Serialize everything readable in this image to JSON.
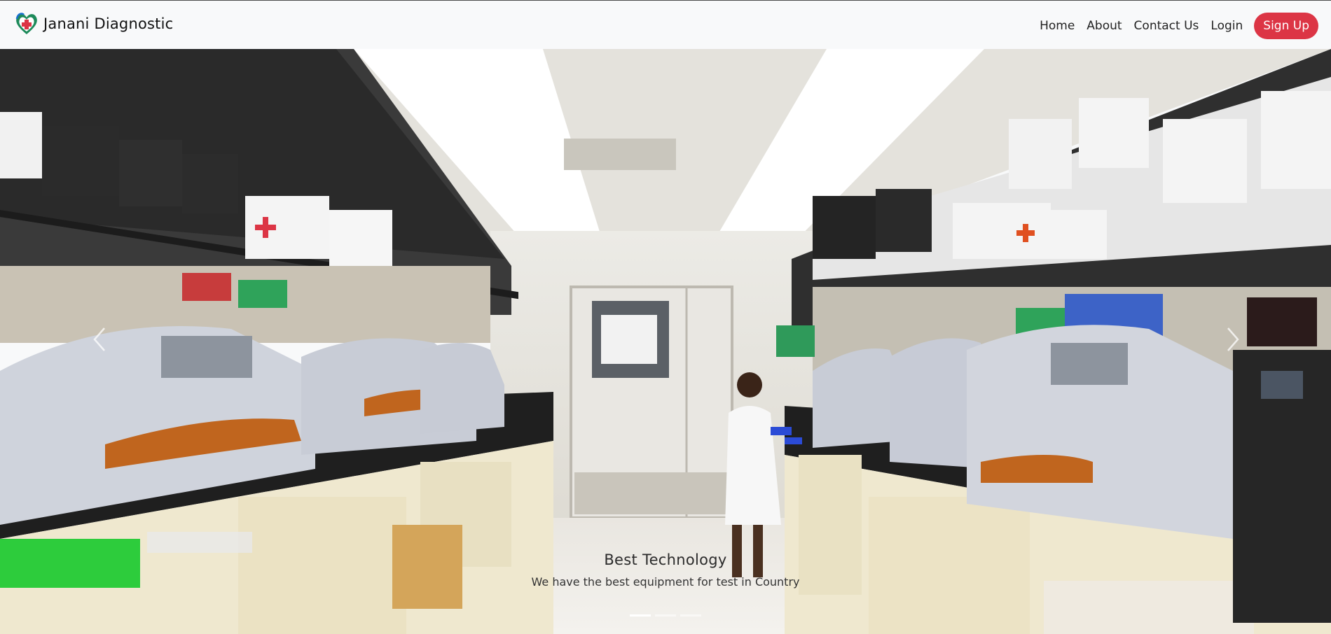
{
  "brand": {
    "name": "Janani Diagnostic",
    "logo_icon": "heart-cross-logo-icon"
  },
  "nav": {
    "items": [
      {
        "label": "Home"
      },
      {
        "label": "About"
      },
      {
        "label": "Contact Us"
      },
      {
        "label": "Login"
      }
    ],
    "signup_label": "Sign Up"
  },
  "colors": {
    "accent": "#dc3545",
    "navbar_bg": "#f8f9fa"
  },
  "carousel": {
    "slide_image": "laboratory-photo",
    "caption_title": "Best Technology",
    "caption_text": "We have the best equipment for test in Country",
    "slide_count": 3,
    "active_slide": 1,
    "prev_icon": "chevron-left-icon",
    "next_icon": "chevron-right-icon"
  }
}
